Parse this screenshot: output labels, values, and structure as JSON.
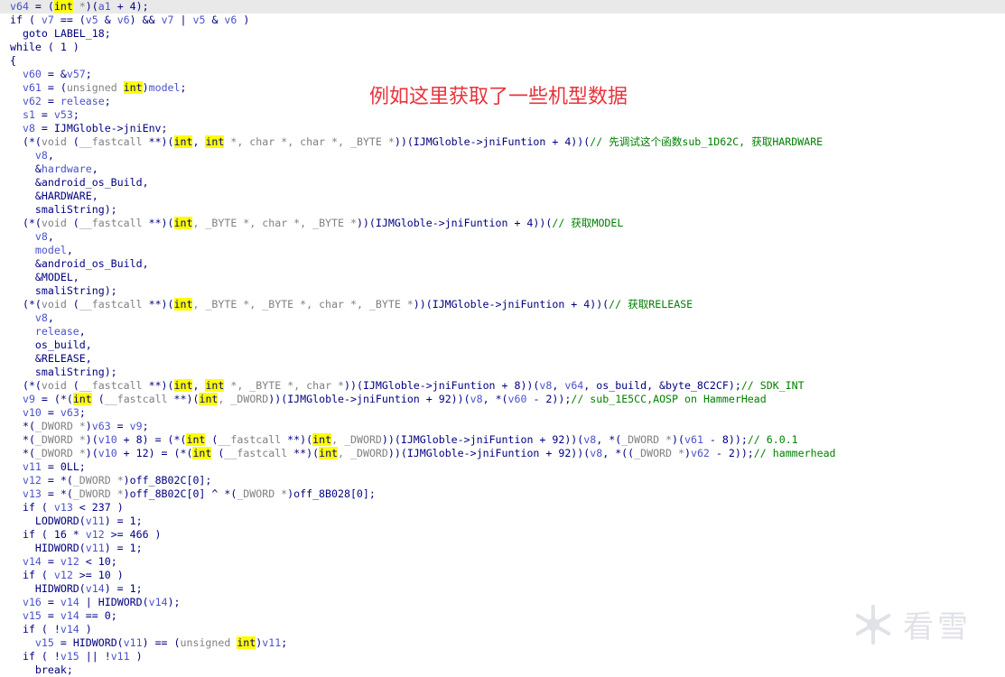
{
  "colors": {
    "identifier": "#4a52c9",
    "type": "#808080",
    "comment": "#008000",
    "keyword": "#000080",
    "highlight": "#ffff00",
    "annotation": "#e8333b"
  },
  "annotation_text": "例如这里获取了一些机型数据",
  "watermark": {
    "icon": "snowflake-icon",
    "text": "看雪"
  },
  "code_lines": [
    [
      [
        "v",
        "v64"
      ],
      [
        "k",
        " = ("
      ],
      [
        "h",
        "int"
      ],
      [
        "g",
        " *"
      ],
      [
        "k",
        ")("
      ],
      [
        "v",
        "a1"
      ],
      [
        "k",
        " + 4);"
      ]
    ],
    [
      [
        "k",
        "if ( "
      ],
      [
        "v",
        "v7"
      ],
      [
        "k",
        " == ("
      ],
      [
        "v",
        "v5"
      ],
      [
        "k",
        " & "
      ],
      [
        "v",
        "v6"
      ],
      [
        "k",
        ") && "
      ],
      [
        "v",
        "v7"
      ],
      [
        "k",
        " | "
      ],
      [
        "v",
        "v5"
      ],
      [
        "k",
        " & "
      ],
      [
        "v",
        "v6"
      ],
      [
        "k",
        " )"
      ]
    ],
    [
      [
        "k",
        "  goto LABEL_18;"
      ]
    ],
    [
      [
        "k",
        "while ( 1 )"
      ]
    ],
    [
      [
        "k",
        "{"
      ]
    ],
    [
      [
        "k",
        "  "
      ],
      [
        "v",
        "v60"
      ],
      [
        "k",
        " = &"
      ],
      [
        "v",
        "v57"
      ],
      [
        "k",
        ";"
      ]
    ],
    [
      [
        "k",
        "  "
      ],
      [
        "v",
        "v61"
      ],
      [
        "k",
        " = ("
      ],
      [
        "g",
        "unsigned "
      ],
      [
        "h",
        "int"
      ],
      [
        "k",
        ")"
      ],
      [
        "v",
        "model"
      ],
      [
        "k",
        ";"
      ]
    ],
    [
      [
        "k",
        "  "
      ],
      [
        "v",
        "v62"
      ],
      [
        "k",
        " = "
      ],
      [
        "v",
        "release"
      ],
      [
        "k",
        ";"
      ]
    ],
    [
      [
        "k",
        "  "
      ],
      [
        "v",
        "s1"
      ],
      [
        "k",
        " = "
      ],
      [
        "v",
        "v53"
      ],
      [
        "k",
        ";"
      ]
    ],
    [
      [
        "k",
        "  "
      ],
      [
        "v",
        "v8"
      ],
      [
        "k",
        " = IJMGloble->jniEnv;"
      ]
    ],
    [
      [
        "k",
        "  (*("
      ],
      [
        "g",
        "void"
      ],
      [
        "k",
        " ("
      ],
      [
        "g",
        "__fastcall"
      ],
      [
        "k",
        " **)("
      ],
      [
        "h",
        "int"
      ],
      [
        "k",
        ", "
      ],
      [
        "h",
        "int"
      ],
      [
        "g",
        " *, char *, char *, _BYTE *"
      ],
      [
        "k",
        "))(IJMGloble->jniFuntion + 4))("
      ],
      [
        "c",
        "// 先调试这个函数sub_1D62C, 获取HARDWARE"
      ]
    ],
    [
      [
        "k",
        "    "
      ],
      [
        "v",
        "v8"
      ],
      [
        "k",
        ","
      ]
    ],
    [
      [
        "k",
        "    &"
      ],
      [
        "v",
        "hardware"
      ],
      [
        "k",
        ","
      ]
    ],
    [
      [
        "k",
        "    &android_os_Build,"
      ]
    ],
    [
      [
        "k",
        "    &HARDWARE,"
      ]
    ],
    [
      [
        "k",
        "    smaliString);"
      ]
    ],
    [
      [
        "k",
        "  (*("
      ],
      [
        "g",
        "void"
      ],
      [
        "k",
        " ("
      ],
      [
        "g",
        "__fastcall"
      ],
      [
        "k",
        " **)("
      ],
      [
        "h",
        "int"
      ],
      [
        "g",
        ", _BYTE *, char *, _BYTE *"
      ],
      [
        "k",
        "))(IJMGloble->jniFuntion + 4))("
      ],
      [
        "c",
        "// 获取MODEL"
      ]
    ],
    [
      [
        "k",
        "    "
      ],
      [
        "v",
        "v8"
      ],
      [
        "k",
        ","
      ]
    ],
    [
      [
        "k",
        "    "
      ],
      [
        "v",
        "model"
      ],
      [
        "k",
        ","
      ]
    ],
    [
      [
        "k",
        "    &android_os_Build,"
      ]
    ],
    [
      [
        "k",
        "    &MODEL,"
      ]
    ],
    [
      [
        "k",
        "    smaliString);"
      ]
    ],
    [
      [
        "k",
        "  (*("
      ],
      [
        "g",
        "void"
      ],
      [
        "k",
        " ("
      ],
      [
        "g",
        "__fastcall"
      ],
      [
        "k",
        " **)("
      ],
      [
        "h",
        "int"
      ],
      [
        "g",
        ", _BYTE *, _BYTE *, char *, _BYTE *"
      ],
      [
        "k",
        "))(IJMGloble->jniFuntion + 4))("
      ],
      [
        "c",
        "// 获取RELEASE"
      ]
    ],
    [
      [
        "k",
        "    "
      ],
      [
        "v",
        "v8"
      ],
      [
        "k",
        ","
      ]
    ],
    [
      [
        "k",
        "    "
      ],
      [
        "v",
        "release"
      ],
      [
        "k",
        ","
      ]
    ],
    [
      [
        "k",
        "    os_build,"
      ]
    ],
    [
      [
        "k",
        "    &RELEASE,"
      ]
    ],
    [
      [
        "k",
        "    smaliString);"
      ]
    ],
    [
      [
        "k",
        "  (*("
      ],
      [
        "g",
        "void"
      ],
      [
        "k",
        " ("
      ],
      [
        "g",
        "__fastcall"
      ],
      [
        "k",
        " **)("
      ],
      [
        "h",
        "int"
      ],
      [
        "k",
        ", "
      ],
      [
        "h",
        "int"
      ],
      [
        "g",
        " *, _BYTE *, char *"
      ],
      [
        "k",
        "))(IJMGloble->jniFuntion + 8))("
      ],
      [
        "v",
        "v8"
      ],
      [
        "k",
        ", "
      ],
      [
        "v",
        "v64"
      ],
      [
        "k",
        ", os_build, &byte_8C2CF);"
      ],
      [
        "c",
        "// SDK_INT"
      ]
    ],
    [
      [
        "k",
        "  "
      ],
      [
        "v",
        "v9"
      ],
      [
        "k",
        " = (*("
      ],
      [
        "h",
        "int"
      ],
      [
        "k",
        " ("
      ],
      [
        "g",
        "__fastcall"
      ],
      [
        "k",
        " **)("
      ],
      [
        "h",
        "int"
      ],
      [
        "g",
        ", _DWORD"
      ],
      [
        "k",
        "))(IJMGloble->jniFuntion + 92))("
      ],
      [
        "v",
        "v8"
      ],
      [
        "k",
        ", *("
      ],
      [
        "v",
        "v60"
      ],
      [
        "k",
        " - 2));"
      ],
      [
        "c",
        "// sub_1E5CC,AOSP on HammerHead"
      ]
    ],
    [
      [
        "k",
        "  "
      ],
      [
        "v",
        "v10"
      ],
      [
        "k",
        " = "
      ],
      [
        "v",
        "v63"
      ],
      [
        "k",
        ";"
      ]
    ],
    [
      [
        "k",
        "  *("
      ],
      [
        "g",
        "_DWORD *"
      ],
      [
        "k",
        ")"
      ],
      [
        "v",
        "v63"
      ],
      [
        "k",
        " = "
      ],
      [
        "v",
        "v9"
      ],
      [
        "k",
        ";"
      ]
    ],
    [
      [
        "k",
        "  *("
      ],
      [
        "g",
        "_DWORD *"
      ],
      [
        "k",
        ")("
      ],
      [
        "v",
        "v10"
      ],
      [
        "k",
        " + 8) = (*("
      ],
      [
        "h",
        "int"
      ],
      [
        "k",
        " ("
      ],
      [
        "g",
        "__fastcall"
      ],
      [
        "k",
        " **)("
      ],
      [
        "h",
        "int"
      ],
      [
        "g",
        ", _DWORD"
      ],
      [
        "k",
        "))(IJMGloble->jniFuntion + 92))("
      ],
      [
        "v",
        "v8"
      ],
      [
        "k",
        ", *("
      ],
      [
        "g",
        "_DWORD *"
      ],
      [
        "k",
        ")("
      ],
      [
        "v",
        "v61"
      ],
      [
        "k",
        " - 8));"
      ],
      [
        "c",
        "// 6.0.1"
      ]
    ],
    [
      [
        "k",
        "  *("
      ],
      [
        "g",
        "_DWORD *"
      ],
      [
        "k",
        ")("
      ],
      [
        "v",
        "v10"
      ],
      [
        "k",
        " + 12) = (*("
      ],
      [
        "h",
        "int"
      ],
      [
        "k",
        " ("
      ],
      [
        "g",
        "__fastcall"
      ],
      [
        "k",
        " **)("
      ],
      [
        "h",
        "int"
      ],
      [
        "g",
        ", _DWORD"
      ],
      [
        "k",
        "))(IJMGloble->jniFuntion + 92))("
      ],
      [
        "v",
        "v8"
      ],
      [
        "k",
        ", *(("
      ],
      [
        "g",
        "_DWORD *"
      ],
      [
        "k",
        ")"
      ],
      [
        "v",
        "v62"
      ],
      [
        "k",
        " - 2));"
      ],
      [
        "c",
        "// hammerhead"
      ]
    ],
    [
      [
        "k",
        "  "
      ],
      [
        "v",
        "v11"
      ],
      [
        "k",
        " = 0LL;"
      ]
    ],
    [
      [
        "k",
        "  "
      ],
      [
        "v",
        "v12"
      ],
      [
        "k",
        " = *("
      ],
      [
        "g",
        "_DWORD *"
      ],
      [
        "k",
        ")off_8B02C[0];"
      ]
    ],
    [
      [
        "k",
        "  "
      ],
      [
        "v",
        "v13"
      ],
      [
        "k",
        " = *("
      ],
      [
        "g",
        "_DWORD *"
      ],
      [
        "k",
        ")off_8B02C[0] ^ *("
      ],
      [
        "g",
        "_DWORD *"
      ],
      [
        "k",
        ")off_8B028[0];"
      ]
    ],
    [
      [
        "k",
        "  if ( "
      ],
      [
        "v",
        "v13"
      ],
      [
        "k",
        " < 237 )"
      ]
    ],
    [
      [
        "k",
        "    LODWORD("
      ],
      [
        "v",
        "v11"
      ],
      [
        "k",
        ") = 1;"
      ]
    ],
    [
      [
        "k",
        "  if ( 16 * "
      ],
      [
        "v",
        "v12"
      ],
      [
        "k",
        " >= 466 )"
      ]
    ],
    [
      [
        "k",
        "    HIDWORD("
      ],
      [
        "v",
        "v11"
      ],
      [
        "k",
        ") = 1;"
      ]
    ],
    [
      [
        "k",
        "  "
      ],
      [
        "v",
        "v14"
      ],
      [
        "k",
        " = "
      ],
      [
        "v",
        "v12"
      ],
      [
        "k",
        " < 10;"
      ]
    ],
    [
      [
        "k",
        "  if ( "
      ],
      [
        "v",
        "v12"
      ],
      [
        "k",
        " >= 10 )"
      ]
    ],
    [
      [
        "k",
        "    HIDWORD("
      ],
      [
        "v",
        "v14"
      ],
      [
        "k",
        ") = 1;"
      ]
    ],
    [
      [
        "k",
        "  "
      ],
      [
        "v",
        "v16"
      ],
      [
        "k",
        " = "
      ],
      [
        "v",
        "v14"
      ],
      [
        "k",
        " | HIDWORD("
      ],
      [
        "v",
        "v14"
      ],
      [
        "k",
        ");"
      ]
    ],
    [
      [
        "k",
        "  "
      ],
      [
        "v",
        "v15"
      ],
      [
        "k",
        " = "
      ],
      [
        "v",
        "v14"
      ],
      [
        "k",
        " == 0;"
      ]
    ],
    [
      [
        "k",
        "  if ( !"
      ],
      [
        "v",
        "v14"
      ],
      [
        "k",
        " )"
      ]
    ],
    [
      [
        "k",
        "    "
      ],
      [
        "v",
        "v15"
      ],
      [
        "k",
        " = HIDWORD("
      ],
      [
        "v",
        "v11"
      ],
      [
        "k",
        ") == ("
      ],
      [
        "g",
        "unsigned "
      ],
      [
        "h",
        "int"
      ],
      [
        "k",
        ")"
      ],
      [
        "v",
        "v11"
      ],
      [
        "k",
        ";"
      ]
    ],
    [
      [
        "k",
        "  if ( !"
      ],
      [
        "v",
        "v15"
      ],
      [
        "k",
        " || !"
      ],
      [
        "v",
        "v11"
      ],
      [
        "k",
        " )"
      ]
    ],
    [
      [
        "k",
        "    break;"
      ]
    ]
  ]
}
